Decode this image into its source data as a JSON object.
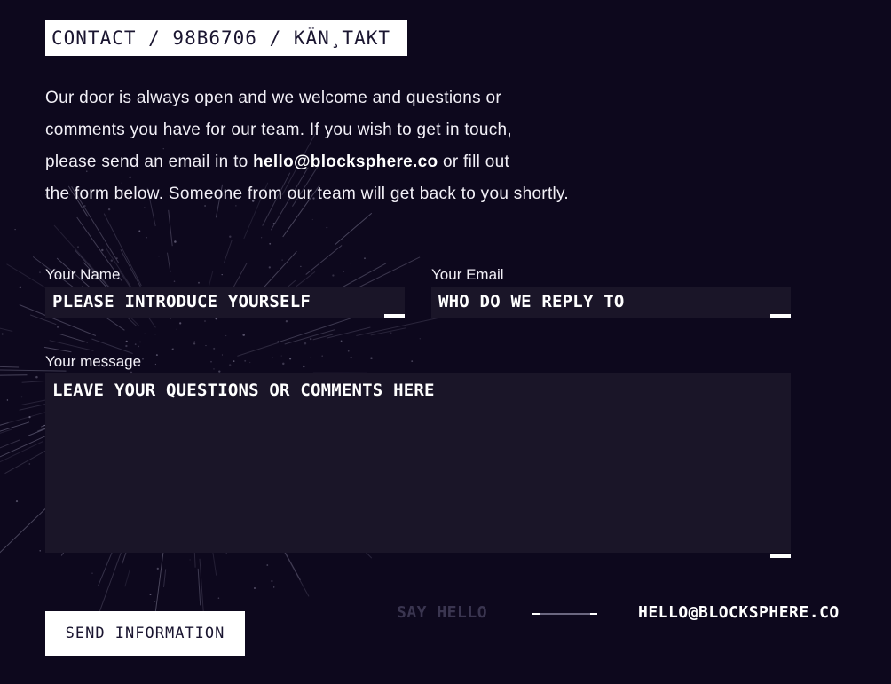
{
  "page": {
    "title": "CONTACT / 98B6706 / KÄN¸TAKT"
  },
  "intro": {
    "line1": "Our door is always open and we welcome and questions or",
    "line2": "comments you have for our team. If you wish to get in touch,",
    "line3_before": "please send an email in to ",
    "line3_email": "hello@blocksphere.co",
    "line3_after": " or fill out",
    "line4": "the form below. Someone from our team will get back to you shortly."
  },
  "form": {
    "name": {
      "label": "Your Name",
      "placeholder": "PLEASE INTRODUCE YOURSELF"
    },
    "email": {
      "label": "Your Email",
      "placeholder": "WHO DO WE REPLY TO"
    },
    "message": {
      "label": "Your message",
      "placeholder": "LEAVE YOUR QUESTIONS OR COMMENTS HERE"
    },
    "submit_label": "SEND INFORMATION"
  },
  "footer": {
    "say_hello": "SAY HELLO",
    "email": "HELLO@BLOCKSPHERE.CO"
  },
  "colors": {
    "background": "#0d081d",
    "field": "#1a1528",
    "muted_text": "#3a3550",
    "accent": "#ffffff"
  }
}
